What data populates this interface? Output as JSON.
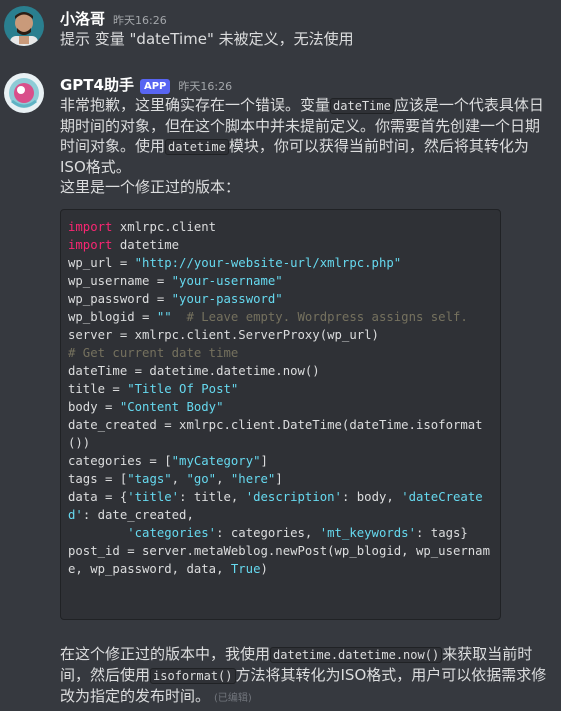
{
  "messages": [
    {
      "username": "小洛哥",
      "timestamp": "昨天16:26",
      "text": "提示 变量 \"dateTime\" 未被定义，无法使用"
    },
    {
      "username": "GPT4助手",
      "badge": "APP",
      "timestamp": "昨天16:26",
      "intro_parts": [
        "非常抱歉，这里确实存在一个错误。变量",
        "dateTime",
        "应该是一个代表具体日期时间的对象，但在这个脚本中并未提前定义。你需要首先创建一个日期时间对象。使用",
        "datetime",
        "模块，你可以获得当前时间，然后将其转化为ISO格式。"
      ],
      "intro2": "这里是一个修正过的版本：",
      "code_lines": [
        [
          [
            "kw",
            "import"
          ],
          [
            "t",
            " xmlrpc.client"
          ]
        ],
        [
          [
            "kw",
            "import"
          ],
          [
            "t",
            " datetime"
          ]
        ],
        [
          [
            "t",
            "wp_url = "
          ],
          [
            "str",
            "\"http://your-website-url/xmlrpc.php\""
          ]
        ],
        [
          [
            "t",
            "wp_username = "
          ],
          [
            "str",
            "\"your-username\""
          ]
        ],
        [
          [
            "t",
            "wp_password = "
          ],
          [
            "str",
            "\"your-password\""
          ]
        ],
        [
          [
            "t",
            "wp_blogid = "
          ],
          [
            "str",
            "\"\""
          ],
          [
            "cm",
            "  # Leave empty. Wordpress assigns self."
          ]
        ],
        [
          [
            "t",
            "server = xmlrpc.client.ServerProxy(wp_url)"
          ]
        ],
        [
          [
            "cm",
            "# Get current date time"
          ]
        ],
        [
          [
            "t",
            "dateTime = datetime.datetime.now()"
          ]
        ],
        [
          [
            "t",
            "title = "
          ],
          [
            "str",
            "\"Title Of Post\""
          ]
        ],
        [
          [
            "t",
            "body = "
          ],
          [
            "str",
            "\"Content Body\""
          ]
        ],
        [
          [
            "t",
            "date_created = xmlrpc.client.DateTime(dateTime.isoformat())"
          ]
        ],
        [
          [
            "t",
            "categories = ["
          ],
          [
            "str",
            "\"myCategory\""
          ],
          [
            "t",
            "]"
          ]
        ],
        [
          [
            "t",
            "tags = ["
          ],
          [
            "str",
            "\"tags\""
          ],
          [
            "t",
            ", "
          ],
          [
            "str",
            "\"go\""
          ],
          [
            "t",
            ", "
          ],
          [
            "str",
            "\"here\""
          ],
          [
            "t",
            "]"
          ]
        ],
        [
          [
            "t",
            "data = {"
          ],
          [
            "str",
            "'title'"
          ],
          [
            "t",
            ": title, "
          ],
          [
            "str",
            "'description'"
          ],
          [
            "t",
            ": body, "
          ],
          [
            "str",
            "'dateCreated'"
          ],
          [
            "t",
            ": date_created,"
          ]
        ],
        [
          [
            "t",
            "        "
          ],
          [
            "str",
            "'categories'"
          ],
          [
            "t",
            ": categories, "
          ],
          [
            "str",
            "'mt_keywords'"
          ],
          [
            "t",
            ": tags}"
          ]
        ],
        [
          [
            "t",
            "post_id = server.metaWeblog.newPost(wp_blogid, wp_username, wp_password, data, "
          ],
          [
            "bool",
            "True"
          ],
          [
            "t",
            ")"
          ]
        ]
      ],
      "outro_parts": [
        "在这个修正过的版本中，我使用",
        "datetime.datetime.now()",
        "来获取当前时间，然后使用",
        "isoformat()",
        "方法将其转化为ISO格式，用户可以依据需求修改为指定的发布时间。"
      ],
      "edited": "(已编辑)"
    }
  ]
}
